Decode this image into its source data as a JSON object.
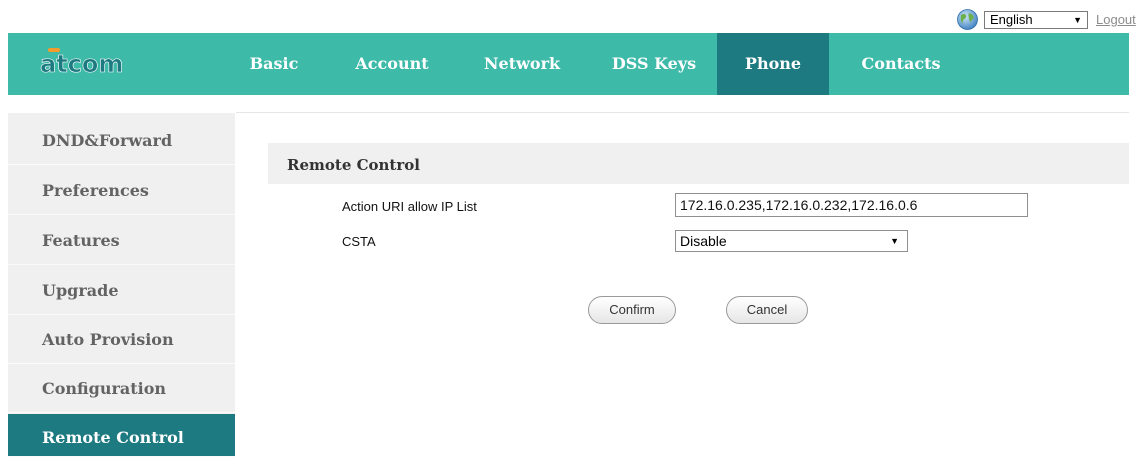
{
  "header": {
    "language": {
      "selected": "English",
      "icon": "globe-icon"
    },
    "logout_label": "Logout",
    "logo_text": "atcom"
  },
  "nav": {
    "items": [
      {
        "label": "Basic",
        "active": false
      },
      {
        "label": "Account",
        "active": false
      },
      {
        "label": "Network",
        "active": false
      },
      {
        "label": "DSS Keys",
        "active": false
      },
      {
        "label": "Phone",
        "active": true
      },
      {
        "label": "Contacts",
        "active": false
      }
    ]
  },
  "sidebar": {
    "items": [
      {
        "label": "DND&Forward",
        "active": false
      },
      {
        "label": "Preferences",
        "active": false
      },
      {
        "label": "Features",
        "active": false
      },
      {
        "label": "Upgrade",
        "active": false
      },
      {
        "label": "Auto Provision",
        "active": false
      },
      {
        "label": "Configuration",
        "active": false
      },
      {
        "label": "Remote Control",
        "active": true
      }
    ]
  },
  "main": {
    "section_title": "Remote Control",
    "fields": {
      "action_uri": {
        "label": "Action URI allow IP List",
        "value": "172.16.0.235,172.16.0.232,172.16.0.6"
      },
      "csta": {
        "label": "CSTA",
        "value": "Disable"
      }
    },
    "buttons": {
      "confirm": "Confirm",
      "cancel": "Cancel"
    }
  },
  "colors": {
    "brand_teal": "#3ebaa8",
    "active_dark_teal": "#1d7a80",
    "logo_text": "#1d7a80"
  }
}
